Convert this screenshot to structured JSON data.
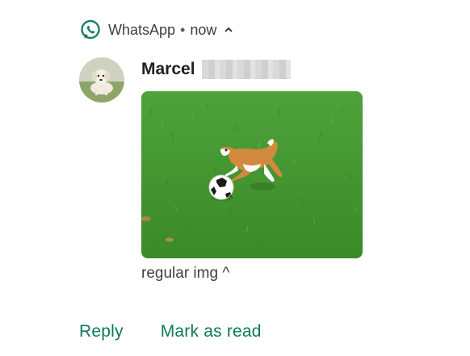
{
  "header": {
    "app_name": "WhatsApp",
    "separator": "•",
    "time": "now",
    "icon": "whatsapp-icon",
    "expand_icon": "chevron-up-icon"
  },
  "message": {
    "sender_name": "Marcel",
    "caption": "regular img ^",
    "avatar_icon": "dog-avatar",
    "image": "puppy-playing-with-soccer-ball"
  },
  "actions": {
    "reply_label": "Reply",
    "mark_read_label": "Mark as read"
  },
  "colors": {
    "accent": "#0b7a5a",
    "app_icon": "#1e7e62",
    "grass": "#3f9a2c"
  }
}
